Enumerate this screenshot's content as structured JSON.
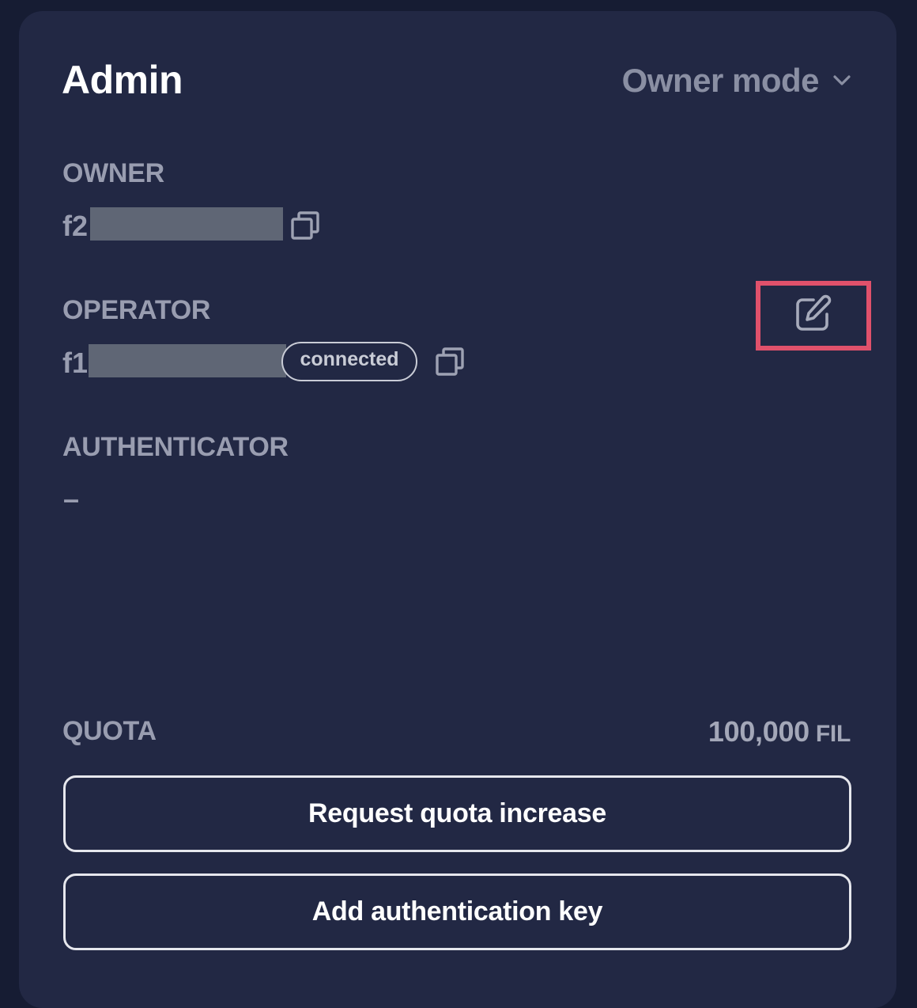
{
  "card": {
    "title": "Admin",
    "mode_label": "Owner mode"
  },
  "owner": {
    "label": "OWNER",
    "address_prefix": "f2"
  },
  "operator": {
    "label": "OPERATOR",
    "address_prefix": "f1",
    "status_badge": "connected"
  },
  "authenticator": {
    "label": "AUTHENTICATOR",
    "value": "–"
  },
  "quota": {
    "label": "QUOTA",
    "value": "100,000",
    "unit": "FIL"
  },
  "actions": {
    "request_quota": "Request quota increase",
    "add_auth_key": "Add authentication key"
  },
  "colors": {
    "background": "#161c33",
    "card": "#222844",
    "highlight": "#e0516b"
  }
}
